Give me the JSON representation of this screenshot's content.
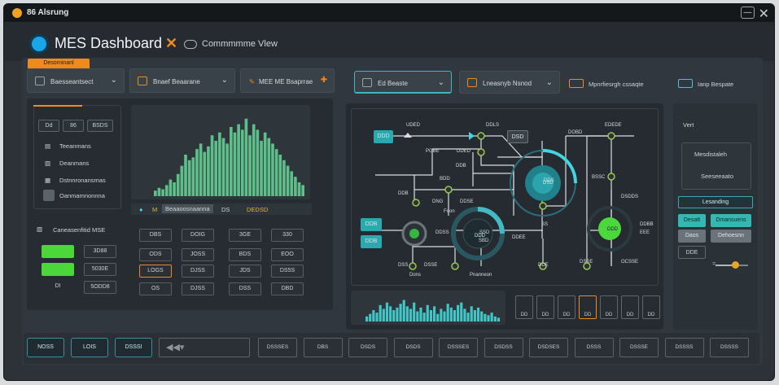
{
  "window": {
    "title": "86 Alsrung",
    "minimize_symbol": "—",
    "close_symbol": "✕"
  },
  "header": {
    "title": "MES Dashboard",
    "view_label": "Commmmme Vlew",
    "tag": "Desorninanl"
  },
  "toolbar": {
    "d1": "Baesseantsect",
    "d2": "Bnaef Beaarane",
    "d3": "MEE ME Bsaprrae",
    "d4": "Ed Beaste",
    "d5": "Lneasnyb Nsnod",
    "d6": "Mpnrfiesrgh cssaqte",
    "d7": "Ianp Bespate"
  },
  "left": {
    "chips": [
      "Dd",
      "86",
      "BSDS"
    ],
    "menu": [
      "Teeanmans",
      "Deanmans",
      "Dstnnronansmas",
      "Oanmamnonnna"
    ],
    "table_title": "Caneasenfitid MSE",
    "rows": [
      [
        "",
        "3D88"
      ],
      [
        "",
        "5030E"
      ],
      [
        "DI",
        "5ODD8"
      ]
    ]
  },
  "center": {
    "legend": [
      "M",
      "Beaaoosnaanna",
      "DS",
      "DEDSD"
    ],
    "grid": [
      [
        "DBS",
        "DOIG",
        "3GE",
        "330"
      ],
      [
        "ODS",
        "JOSS",
        "BDS",
        "EOO"
      ],
      [
        "LOGS",
        "DJSS",
        "JDS",
        "DS5S"
      ],
      [
        "OS",
        "DJSS",
        "DSS",
        "DBD"
      ]
    ]
  },
  "diagram": {
    "nodes": {
      "n1": "UDED",
      "n2": "DDLS",
      "n3": "DOBD",
      "n4": "EDEDE",
      "n5": "PGBE",
      "n6": "DDED",
      "n7": "DDB",
      "n8": "BDD",
      "n9": "DDB",
      "n10": "DNG",
      "n11": "DDSE",
      "n12": "DDS",
      "n13": "BSSC",
      "n14": "DSDDS",
      "n15": "DDBB",
      "n16": "EEE",
      "n17": "DDSS",
      "n18": "SSD",
      "n19": "SBD",
      "n20": "SS",
      "n21": "DDEE",
      "n22": "Foon",
      "n23": "DSSE",
      "n24": "Pnanneon",
      "n25": "DSS",
      "n26": "DSSE",
      "n27": "OCSSE",
      "n28": "Dons",
      "n29": "DDE"
    },
    "boxes": [
      "DDD",
      "DSD",
      "DDB",
      "DDB"
    ],
    "gauges": [
      "DSD",
      "DDD",
      "DDD",
      "DDD"
    ]
  },
  "preview_cells": [
    "DD",
    "DD",
    "DD",
    "DD",
    "DD",
    "DD",
    "DD"
  ],
  "right": {
    "title": "Vert",
    "card": [
      "Mesdistaleh",
      "Seeseeaato"
    ],
    "tab": "Lesanding",
    "buttons": [
      [
        "Desatt",
        "Dmansuens"
      ],
      [
        "Daos",
        "Dehoesnn"
      ],
      [
        "DDE",
        ""
      ]
    ],
    "slider_percent": 60
  },
  "footer": {
    "left": [
      "NOSS",
      "LOIS",
      "DSSSI"
    ],
    "media": "◀◀▾",
    "right": [
      "DSSSES",
      "DBS",
      "DSDS",
      "DSDS",
      "DSSSES",
      "DSDSS",
      "DSDSES",
      "DSSS",
      "DSSSE",
      "DSSSS",
      "DSSSS"
    ]
  },
  "colors": {
    "accent": "#f08a1c",
    "teal": "#33c3c7",
    "green": "#5ce33c",
    "bg": "#2c3238"
  },
  "left_chart": {
    "bars": [
      4,
      6,
      5,
      8,
      12,
      10,
      16,
      22,
      30,
      26,
      28,
      34,
      38,
      32,
      36,
      44,
      40,
      46,
      42,
      38,
      50,
      46,
      52,
      48,
      56,
      44,
      52,
      48,
      40,
      46,
      42,
      38,
      34,
      30,
      26,
      22,
      18,
      14,
      10,
      8
    ]
  },
  "right_chart": {
    "bars": [
      8,
      12,
      18,
      14,
      26,
      20,
      30,
      24,
      18,
      22,
      28,
      34,
      24,
      20,
      30,
      16,
      22,
      14,
      26,
      18,
      24,
      12,
      20,
      16,
      28,
      22,
      18,
      26,
      30,
      20,
      14,
      24,
      18,
      22,
      16,
      12,
      10,
      14,
      8,
      6
    ]
  }
}
